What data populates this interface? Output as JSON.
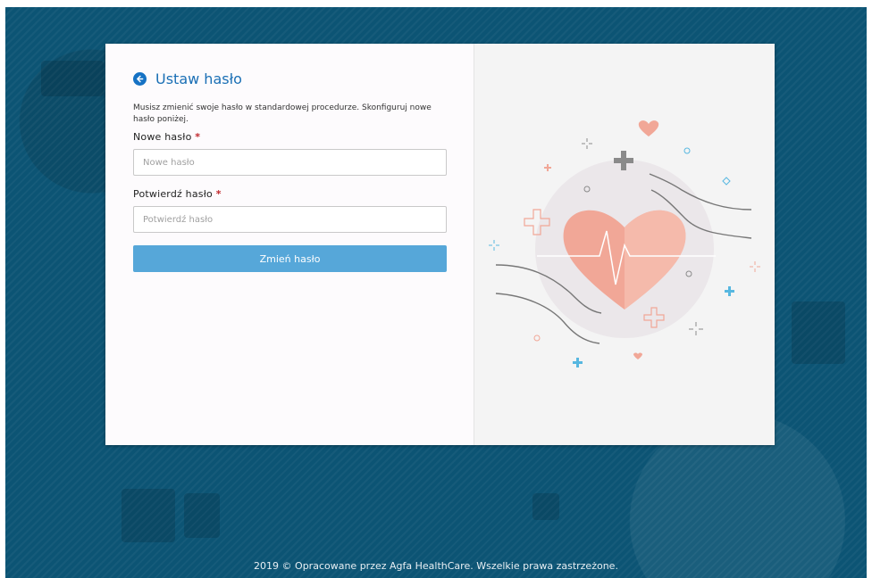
{
  "header": {
    "title": "Ustaw hasło",
    "description": "Musisz zmienić swoje hasło w standardowej procedurze. Skonfiguruj nowe hasło poniżej."
  },
  "form": {
    "new_password": {
      "label": "Nowe hasło",
      "required_mark": "*",
      "value": "",
      "placeholder": "Nowe hasło"
    },
    "confirm_password": {
      "label": "Potwierdź hasło",
      "required_mark": "*",
      "value": "",
      "placeholder": "Potwierdź hasło"
    },
    "submit_label": "Zmień hasło"
  },
  "footer": {
    "text": "2019 © Opracowane przez Agfa HealthCare. Wszelkie prawa zastrzeżone."
  },
  "icons": {
    "back": "arrow-left-circle-icon"
  },
  "colors": {
    "background": "#0c5474",
    "accent": "#1a6fb5",
    "button": "#56a7d9",
    "required": "#c0282d",
    "heart": "#f0a596"
  }
}
